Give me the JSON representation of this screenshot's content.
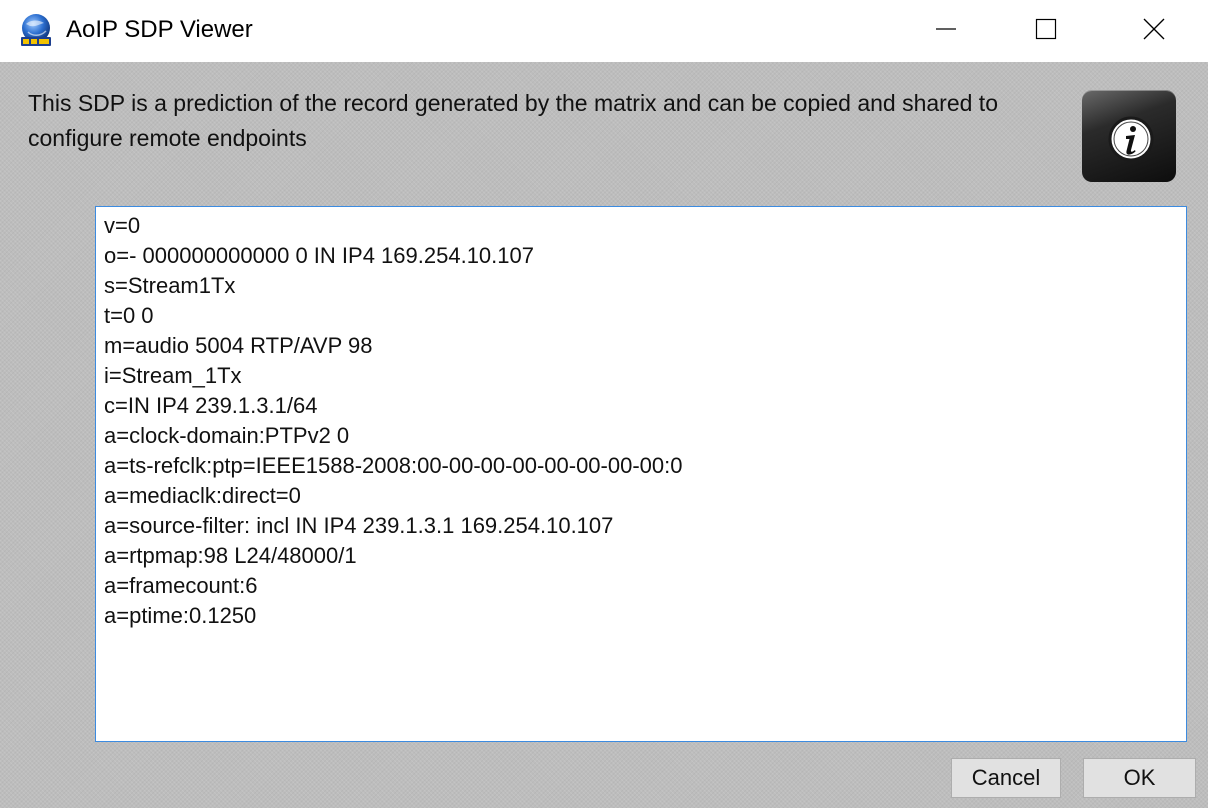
{
  "window": {
    "title": "AoIP SDP Viewer",
    "app_icon": "globe-app-icon",
    "controls": {
      "minimize": "minimize-icon",
      "maximize": "maximize-icon",
      "close": "close-icon"
    }
  },
  "info": {
    "message": "This SDP is a prediction of the record generated by the matrix and can be copied and shared to configure remote endpoints",
    "icon": "info-icon"
  },
  "sdp": {
    "lines": [
      "v=0",
      "o=- 000000000000 0 IN IP4 169.254.10.107",
      "s=Stream1Tx",
      "t=0 0",
      "m=audio 5004 RTP/AVP 98",
      "i=Stream_1Tx",
      "c=IN IP4 239.1.3.1/64",
      "a=clock-domain:PTPv2 0",
      "a=ts-refclk:ptp=IEEE1588-2008:00-00-00-00-00-00-00-00:0",
      "a=mediaclk:direct=0",
      "a=source-filter: incl IN IP4 239.1.3.1 169.254.10.107",
      "a=rtpmap:98 L24/48000/1",
      "a=framecount:6",
      "a=ptime:0.1250"
    ]
  },
  "buttons": {
    "cancel": "Cancel",
    "ok": "OK"
  },
  "colors": {
    "client_background": "#bdbdbd",
    "textbox_border": "#3c8be0",
    "button_face": "#e1e1e1"
  }
}
